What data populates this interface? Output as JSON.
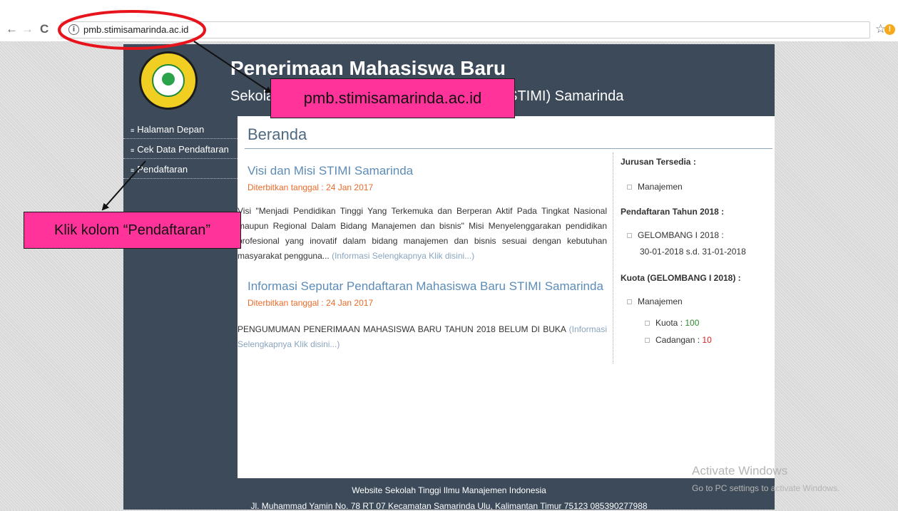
{
  "browser": {
    "back_icon": "←",
    "forward_icon": "→",
    "reload_icon": "C",
    "info_icon": "i",
    "url": "pmb.stimisamarinda.ac.id",
    "star_icon": "☆",
    "alert_icon": "!"
  },
  "site": {
    "title": "Penerimaan Mahasiswa Baru",
    "subtitle": "Sekolah Tinggi Ilmu Manajemen Indonesia (STIMI) Samarinda",
    "logo_icon": "college-seal-logo"
  },
  "sidebar": {
    "items": [
      {
        "label": "Halaman Depan"
      },
      {
        "label": "Cek Data Pendaftaran"
      },
      {
        "label": "Pendaftaran"
      }
    ]
  },
  "main": {
    "title": "Beranda",
    "articles": [
      {
        "title": "Visi dan Misi STIMI Samarinda",
        "date": "Diterbitkan tanggal : 24 Jan 2017",
        "body": "Visi \"Menjadi Pendidikan Tinggi Yang Terkemuka dan Berperan Aktif Pada Tingkat Nasional maupun Regional Dalam Bidang Manajemen dan bisnis\" Misi Menyelenggarakan pendidikan profesional yang inovatif dalam bidang manajemen dan bisnis sesuai dengan kebutuhan masyarakat pengguna...",
        "more": "(Informasi Selengkapnya Klik disini...)"
      },
      {
        "title": "Informasi Seputar Pendaftaran Mahasiswa Baru STIMI Samarinda",
        "date": "Diterbitkan tanggal : 24 Jan 2017",
        "body": "PENGUMUMAN PENERIMAAN MAHASISWA BARU TAHUN 2018 BELUM DI BUKA",
        "more": "(Informasi Selengkapnya Klik disini...)"
      }
    ]
  },
  "right": {
    "jurusan_heading": "Jurusan Tersedia :",
    "jurusan_item": "Manajemen",
    "pendaftaran_heading": "Pendaftaran Tahun 2018 :",
    "gelombang_label": "GELOMBANG I 2018 :",
    "gelombang_dates": "30-01-2018 s.d. 31-01-2018",
    "kuota_heading": "Kuota (GELOMBANG I 2018) :",
    "kuota_jurusan": "Manajemen",
    "kuota_label": "Kuota : ",
    "kuota_value": "100",
    "cadangan_label": "Cadangan : ",
    "cadangan_value": "10"
  },
  "footer": {
    "line1": "Website Sekolah Tinggi Ilmu Manajemen Indonesia",
    "line2": "Jl. Muhammad Yamin No. 78 RT 07 Kecamatan Samarinda Ulu, Kalimantan Timur 75123 085390277988"
  },
  "watermark": {
    "line1": "Activate Windows",
    "line2": "Go to PC settings to activate Windows."
  },
  "annotations": {
    "url_callout": "pmb.stimisamarinda.ac.id",
    "click_callout": "Klik kolom “Pendaftaran”"
  },
  "colors": {
    "header_bg": "#3c4a5a",
    "callout_bg": "#ff3399",
    "url_circle": "#e8141c",
    "article_title": "#5c8cb7",
    "date": "#e96b2a"
  }
}
